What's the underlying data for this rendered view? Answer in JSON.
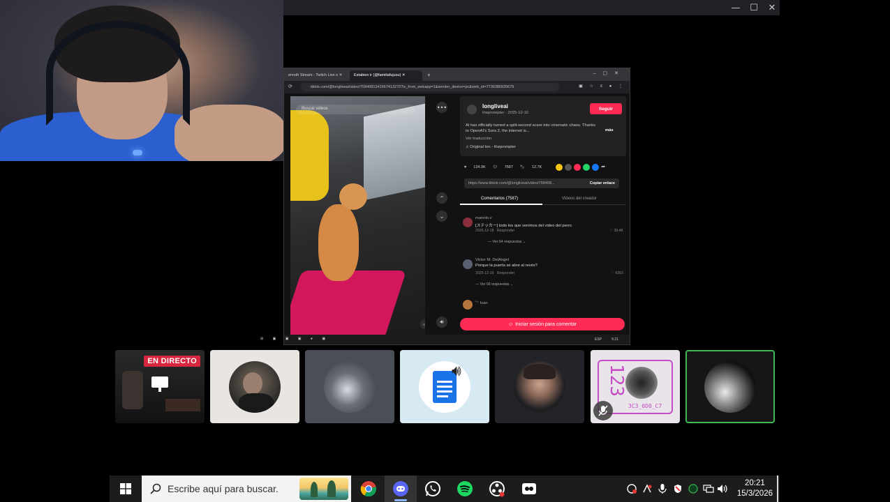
{
  "shared_screen": {
    "browser": {
      "tabs": [
        "emoth Stream - Twitch Live o",
        "Estabien ir (@familiafujusu)"
      ],
      "url": "tiktok.com/@longliveai/video/7584081341667413270?is_from_webapp=1&sender_device=pc&web_id=7736380935679"
    },
    "video": {
      "search_placeholder": "Buscar videos"
    },
    "post": {
      "author": "longliveai",
      "author_meta": "theprompter · 2025-12-15",
      "follow_label": "Seguir",
      "description": "AI has officially turned a split-second scare into cinematic chaos. Thanks to OpenAI's Sora 2, the internet is...",
      "more_label": "más",
      "translation_label": "Ver traducción",
      "sound": "Original ton - theprompter",
      "likes": "124.9K",
      "comments_count": "7587",
      "saves": "12.7K",
      "link_text": "https://www.tiktok.com/@longliveai/video/758408...",
      "copy_label": "Copiar enlace",
      "tab_comments": "Comentarios (7587)",
      "tab_creator": "Videos del creador",
      "login_label": "Iniciar sesión para comentar"
    },
    "comments": [
      {
        "user": "manolo.v",
        "text": "[ステッカー] todo los que venimos del video del perro",
        "date": "2025-12-18",
        "reply_label": "Responder",
        "likes": "39.4K",
        "replies_label": "Ver 64 respuestas"
      },
      {
        "user": "Victor M. DelAngel",
        "text": "Porque la puerta se abre al revés?",
        "date": "2025-12-16",
        "reply_label": "Responder",
        "likes": "6352",
        "replies_label": "Ver 66 respuestas"
      },
      {
        "user": "˚⁺ Ivan",
        "text": "",
        "date": "",
        "reply_label": "",
        "likes": "",
        "replies_label": ""
      }
    ],
    "mini_taskbar": {
      "lang": "ESP",
      "time": "6:21"
    }
  },
  "participants": {
    "live_label": "EN DIRECTO",
    "tile5_text": "123",
    "tile5_caption": "3C3_0D0_C7"
  },
  "taskbar": {
    "search_placeholder": "Escribe aquí para buscar.",
    "time": "20:21",
    "date": "15/3/2026"
  }
}
